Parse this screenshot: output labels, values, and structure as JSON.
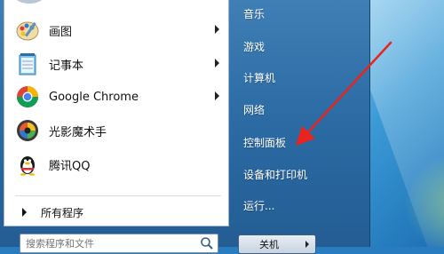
{
  "left_programs": [
    {
      "label": "画图",
      "icon": "paint-icon",
      "has_submenu": true
    },
    {
      "label": "记事本",
      "icon": "notepad-icon",
      "has_submenu": true
    },
    {
      "label": "Google Chrome",
      "icon": "chrome-icon",
      "has_submenu": true
    },
    {
      "label": "光影魔术手",
      "icon": "photo-magic-icon",
      "has_submenu": false
    },
    {
      "label": "腾讯QQ",
      "icon": "qq-penguin-icon",
      "has_submenu": false
    }
  ],
  "all_programs_label": "所有程序",
  "search": {
    "placeholder": "搜索程序和文件"
  },
  "right_items": [
    {
      "label": "音乐"
    },
    {
      "label": "游戏"
    },
    {
      "label": "计算机"
    },
    {
      "label": "网络"
    },
    {
      "label": "控制面板"
    },
    {
      "label": "设备和打印机"
    },
    {
      "label": "运行..."
    }
  ],
  "shutdown_label": "关机",
  "annotation_color": "#e8241c"
}
